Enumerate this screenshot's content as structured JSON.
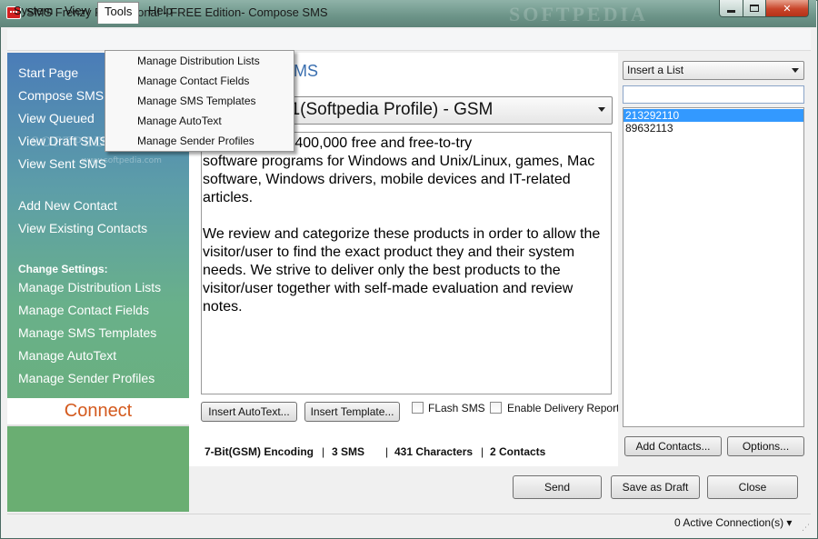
{
  "window": {
    "title": "SMS Frenzy Professional - FREE Edition- Compose SMS",
    "watermark": "SOFTPEDIA"
  },
  "menubar": {
    "items": [
      "System",
      "View",
      "Tools",
      "Help"
    ]
  },
  "tools_menu": {
    "items": [
      "Manage Distribution Lists",
      "Manage Contact Fields",
      "Manage SMS Templates",
      "Manage AutoText",
      "Manage Sender Profiles"
    ]
  },
  "sidebar": {
    "nav": [
      "Start Page",
      "Compose SMS",
      "View Queued",
      "View Draft SMS",
      "View Sent SMS"
    ],
    "contacts": [
      "Add New Contact",
      "View Existing Contacts"
    ],
    "settings_heading": "Change Settings:",
    "settings": [
      "Manage Distribution Lists",
      "Manage Contact Fields",
      "Manage SMS Templates",
      "Manage AutoText",
      "Manage Sender Profiles"
    ],
    "connect_label": "Connect",
    "watermark": "SOFTPEDIA",
    "watermark_sub": "www.softpedia.com"
  },
  "compose": {
    "title": "SMS",
    "profile": "21(Softpedia Profile) - GSM",
    "message": "library of over 400,000 free and free-to-try\nsoftware programs for Windows and Unix/Linux, games, Mac\nsoftware, Windows drivers, mobile devices and IT-related\narticles.\n\nWe review and categorize these products in order to allow the\nvisitor/user to find the exact product they and their system\nneeds. We strive to deliver only the best products to the\nvisitor/user together with self-made evaluation and review\nnotes.",
    "insert_autotext": "Insert AutoText...",
    "insert_template": "Insert Template...",
    "flash_sms": "FLash SMS",
    "delivery_report": "Enable Delivery Report",
    "status": {
      "encoding": "7-Bit(GSM) Encoding",
      "sms_count": "3 SMS",
      "characters": "431 Characters",
      "contacts": "2 Contacts"
    }
  },
  "recipients": {
    "list_select": "Insert a List",
    "search_value": "",
    "numbers": [
      "213292110",
      "89632113"
    ],
    "add_contacts": "Add Contacts...",
    "options": "Options..."
  },
  "actions": {
    "send": "Send",
    "save_draft": "Save as Draft",
    "close": "Close"
  },
  "statusbar": {
    "connections": "0 Active Connection(s)"
  },
  "colors": {
    "accent_blue": "#3a6fb0",
    "connect_orange": "#d45a1e",
    "selection": "#3399ff",
    "close_red": "#c8442a"
  }
}
